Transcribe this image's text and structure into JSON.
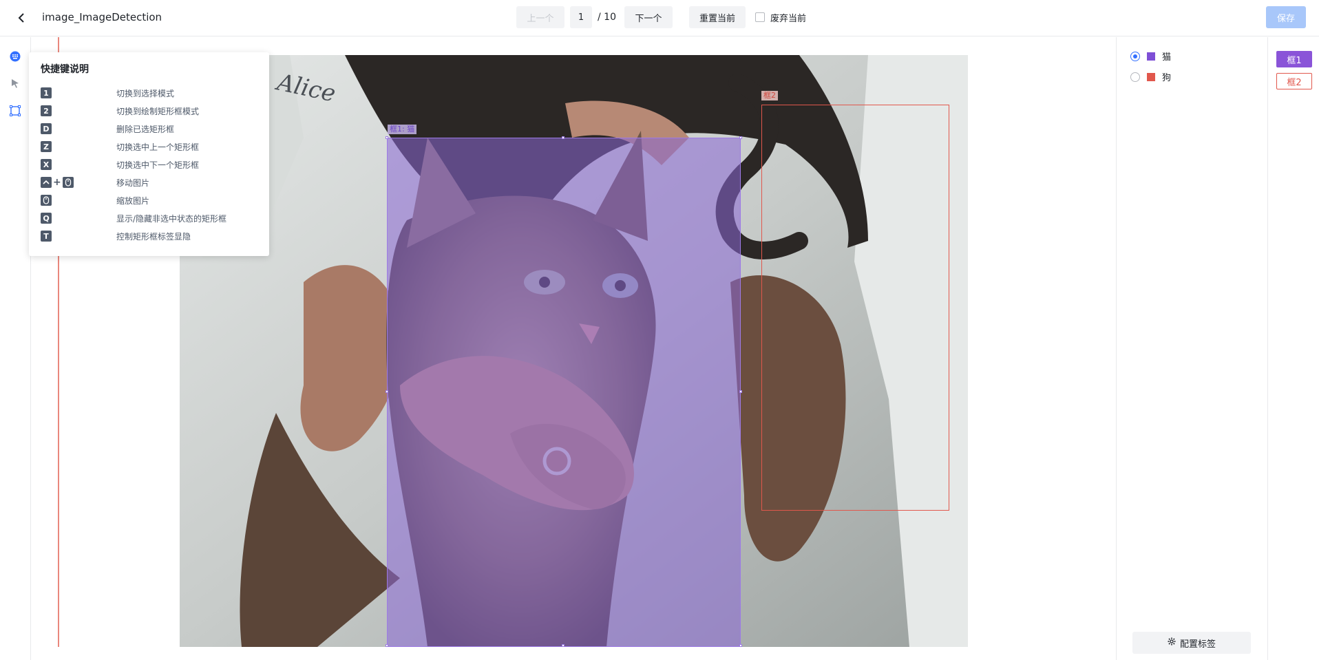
{
  "header": {
    "title": "image_ImageDetection",
    "prev_label": "上一个",
    "page_current": "1",
    "page_total": "/ 10",
    "next_label": "下一个",
    "reset_label": "重置当前",
    "discard_label": "废弃当前",
    "save_label": "保存"
  },
  "tools": [
    "keyboard-icon",
    "pointer-select-icon",
    "rectangle-draw-icon"
  ],
  "shortcuts": {
    "title": "快捷键说明",
    "items": [
      {
        "key": "1",
        "desc": "切换到选择模式"
      },
      {
        "key": "2",
        "desc": "切换到绘制矩形框模式"
      },
      {
        "key": "D",
        "desc": "删除已选矩形框"
      },
      {
        "key": "Z",
        "desc": "切换选中上一个矩形框"
      },
      {
        "key": "X",
        "desc": "切换选中下一个矩形框"
      },
      {
        "key": "^+mouse",
        "desc": "移动图片"
      },
      {
        "key": "mouse",
        "desc": "缩放图片"
      },
      {
        "key": "Q",
        "desc": "显示/隐藏非选中状态的矩形框"
      },
      {
        "key": "T",
        "desc": "控制矩形框标签显隐"
      }
    ]
  },
  "canvas": {
    "box1_label": "框1: 猫",
    "box2_label": "框2",
    "photo_text": "Alice"
  },
  "labels": {
    "items": [
      {
        "name": "猫",
        "color": "#7e4fd6",
        "selected": true
      },
      {
        "name": "狗",
        "color": "#e1574c",
        "selected": false
      }
    ],
    "config_label": "配置标签"
  },
  "boxes": {
    "items": [
      {
        "name": "框1",
        "color": "#8a54d8"
      },
      {
        "name": "框2",
        "color": "#e1574c"
      }
    ]
  }
}
